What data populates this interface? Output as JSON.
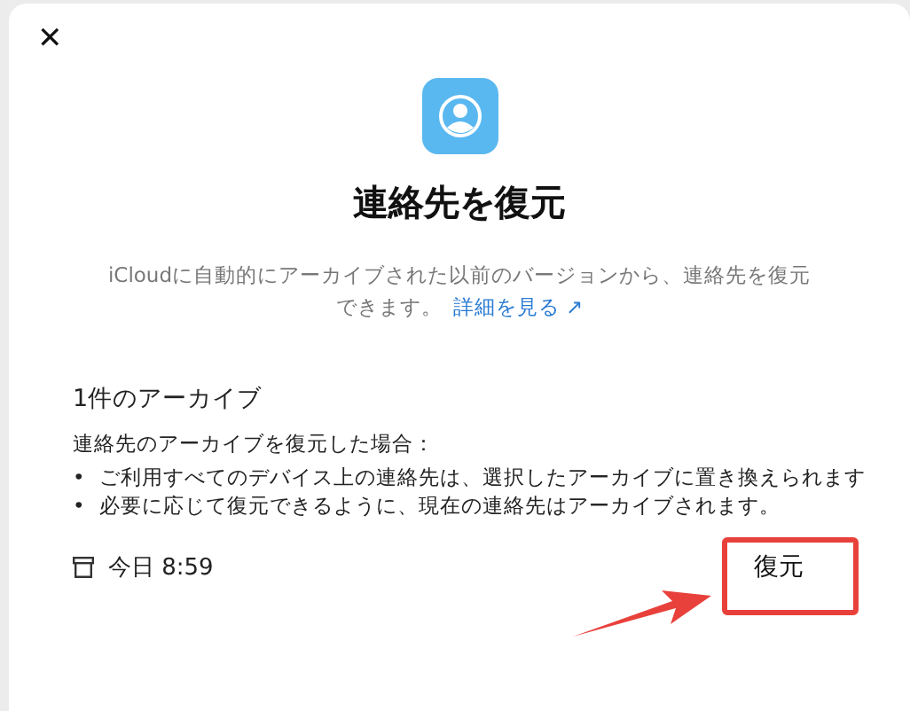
{
  "dialog": {
    "close": "✕",
    "title": "連絡先を復元",
    "description": "iCloudに自動的にアーカイブされた以前のバージョンから、連絡先を復元できます。",
    "link": "詳細を見る ↗"
  },
  "archives": {
    "heading": "1件のアーカイブ",
    "intro": "連絡先のアーカイブを復元した場合：",
    "bullet_marker": "•",
    "bullets": [
      "ご利用すべてのデバイス上の連絡先は、選択したアーカイブに置き換えられます",
      "必要に応じて復元できるように、現在の連絡先はアーカイブされます。"
    ],
    "items": [
      {
        "date": "今日 8:59",
        "button": "復元"
      }
    ]
  }
}
